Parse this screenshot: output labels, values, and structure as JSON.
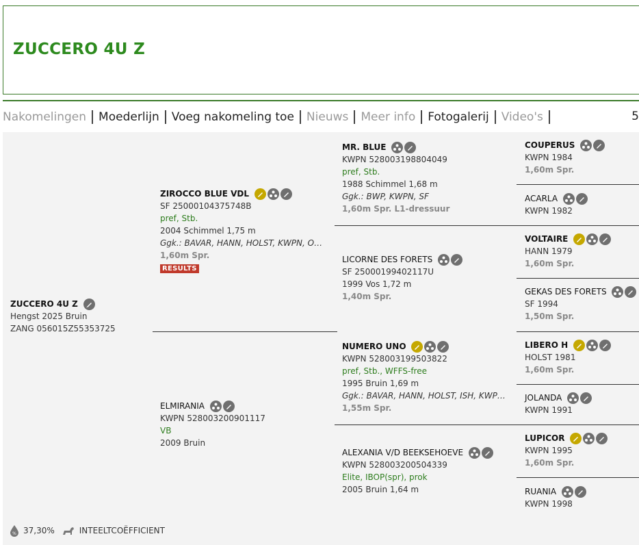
{
  "title": "ZUCCERO 4U Z",
  "nav": {
    "items": [
      {
        "label": "Nakomelingen",
        "dim": true
      },
      {
        "label": "Moederlijn",
        "dim": false
      },
      {
        "label": "Voeg nakomeling toe",
        "dim": false
      },
      {
        "label": "Nieuws",
        "dim": true
      },
      {
        "label": "Meer info",
        "dim": true
      },
      {
        "label": "Fotogalerij",
        "dim": false
      },
      {
        "label": "Video's",
        "dim": true
      }
    ],
    "extra": "5"
  },
  "subject": {
    "name": "ZUCCERO 4U Z",
    "line1": "Hengst 2025 Bruin",
    "line2": "ZANG 056015Z55353725"
  },
  "sire": {
    "name": "ZIROCCO BLUE VDL",
    "reg": "SF 25000104375748B",
    "pref": "pref, Stb.",
    "info": "2004 Schimmel 1,75 m",
    "ggk": "Ggk.: BAVAR, HANN, HOLST, KWPN, OS, RHEINLAND, SF, ZANG",
    "perf": "1,60m Spr.",
    "results": "RESULTS"
  },
  "dam": {
    "name": "ELMIRANIA",
    "reg": "KWPN 528003200901117",
    "pref": "VB",
    "info": "2009 Bruin"
  },
  "ss": {
    "name": "MR. BLUE",
    "reg": "KWPN 528003198804049",
    "pref": "pref, Stb.",
    "info": "1988 Schimmel 1,68 m",
    "ggk": "Ggk.: BWP, KWPN, SF",
    "perf": "1,60m Spr. L1-dressuur"
  },
  "sd": {
    "name": "LICORNE DES FORETS",
    "reg": "SF 25000199402117U",
    "info": "1999 Vos 1,72 m",
    "perf": "1,40m Spr."
  },
  "ds": {
    "name": "NUMERO UNO",
    "reg": "KWPN 528003199503822",
    "pref": "pref, Stb., WFFS-free",
    "info": "1995 Bruin 1,69 m",
    "ggk": "Ggk.: BAVAR, HANN, HOLST, ISH, KWPN, MIPAAF, OS",
    "perf": "1,55m Spr."
  },
  "dd": {
    "name": "ALEXANIA V/D BEEKSEHOEVE",
    "reg": "KWPN 528003200504339",
    "pref": "Elite, IBOP(spr), prok",
    "info": "2005 Bruin 1,64 m"
  },
  "g1": {
    "name": "COUPERUS",
    "reg": "KWPN 1984",
    "perf": "1,60m Spr."
  },
  "g2": {
    "name": "ACARLA",
    "reg": "KWPN 1982"
  },
  "g3": {
    "name": "VOLTAIRE",
    "reg": "HANN 1979",
    "perf": "1,60m Spr."
  },
  "g4": {
    "name": "GEKAS DES FORETS",
    "reg": "SF 1994",
    "perf": "1,50m Spr."
  },
  "g5": {
    "name": "LIBERO H",
    "reg": "HOLST 1981",
    "perf": "1,60m Spr."
  },
  "g6": {
    "name": "JOLANDA",
    "reg": "KWPN 1991"
  },
  "g7": {
    "name": "LUPICOR",
    "reg": "KWPN 1995",
    "perf": "1,60m Spr."
  },
  "g8": {
    "name": "RUANIA",
    "reg": "KWPN 1998"
  },
  "footer": {
    "percent": "37,30%",
    "label": "INTEELTCOËFFICIENT"
  },
  "colors": {
    "brand_green": "#2d8a1e",
    "border_green": "#3a7a28",
    "gold_icon": "#c5a800",
    "results_red": "#c0392b"
  }
}
